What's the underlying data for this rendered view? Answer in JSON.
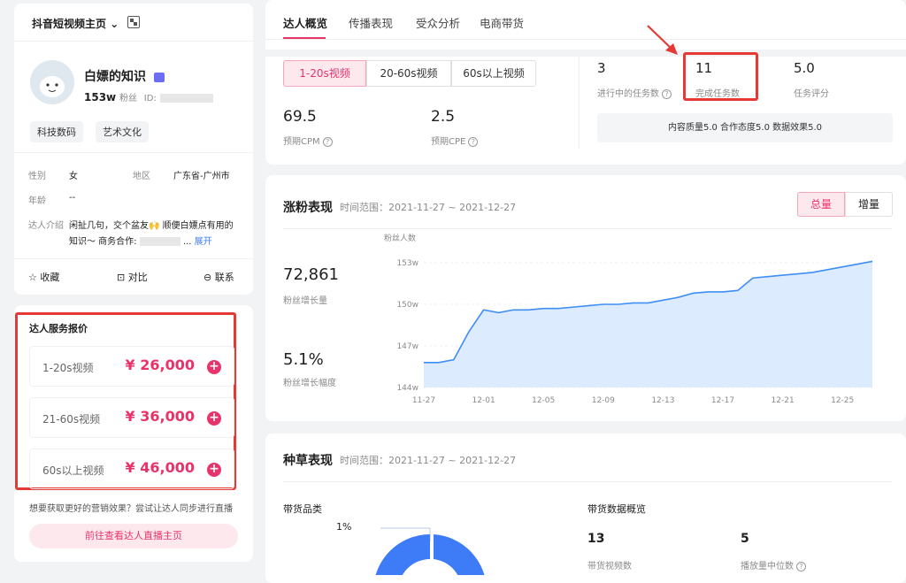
{
  "profile": {
    "platform_label": "抖音短视频主页",
    "name": "白嫖的知识",
    "followers": "153w",
    "followers_unit": "粉丝",
    "id_label": "ID:",
    "tags": [
      "科技数码",
      "艺术文化"
    ],
    "gender_label": "性别",
    "gender": "女",
    "region_label": "地区",
    "region": "广东省-广州市",
    "age_label": "年龄",
    "age": "--",
    "intro_label": "达人介绍",
    "intro_line1": "闲扯几句，交个盆友🙌 顺便白嫖点有用的",
    "intro_line2": "知识～ 商务合作:",
    "expand": "展开",
    "actions": {
      "favorite": "收藏",
      "compare": "对比",
      "contact": "联系"
    }
  },
  "pricing": {
    "title": "达人服务报价",
    "rows": [
      {
        "label": "1-20s视频",
        "price": "¥ 26,000"
      },
      {
        "label": "21-60s视频",
        "price": "¥ 36,000"
      },
      {
        "label": "60s以上视频",
        "price": "¥ 46,000"
      }
    ],
    "promo": "想要获取更好的营销效果？尝试让达人同步进行直播",
    "live_button": "前往查看达人直播主页"
  },
  "tabs": [
    "达人概览",
    "传播表现",
    "受众分析",
    "电商带货"
  ],
  "overview": {
    "segments": [
      "1-20s视频",
      "20-60s视频",
      "60s以上视频"
    ],
    "cpm_value": "69.5",
    "cpm_label": "预期CPM",
    "cpe_value": "2.5",
    "cpe_label": "预期CPE",
    "tasks_in_progress": "3",
    "tasks_in_progress_label": "进行中的任务数",
    "tasks_done": "11",
    "tasks_done_label": "完成任务数",
    "task_score": "5.0",
    "task_score_label": "任务评分",
    "quality_line": "内容质量5.0 合作态度5.0 数据效果5.0"
  },
  "growth": {
    "title": "涨粉表现",
    "range": "时间范围：2021-11-27 ~ 2021-12-27",
    "toggle_total": "总量",
    "toggle_incr": "增量",
    "stat_value": "72,861",
    "stat_label": "粉丝增长量",
    "rate_value": "5.1%",
    "rate_label": "粉丝增长幅度"
  },
  "chart_data": {
    "type": "area",
    "ylabel": "粉丝人数",
    "y_ticks": [
      "153w",
      "150w",
      "147w",
      "144w"
    ],
    "x_ticks": [
      "11-27",
      "12-01",
      "12-05",
      "12-09",
      "12-13",
      "12-17",
      "12-21",
      "12-25"
    ],
    "ylim": [
      144,
      153
    ],
    "x": [
      "11-27",
      "11-28",
      "11-29",
      "11-30",
      "12-01",
      "12-02",
      "12-03",
      "12-04",
      "12-05",
      "12-06",
      "12-07",
      "12-08",
      "12-09",
      "12-10",
      "12-11",
      "12-12",
      "12-13",
      "12-14",
      "12-15",
      "12-16",
      "12-17",
      "12-18",
      "12-19",
      "12-20",
      "12-21",
      "12-22",
      "12-23",
      "12-24",
      "12-25",
      "12-26",
      "12-27"
    ],
    "values": [
      145.8,
      145.8,
      146.0,
      148.0,
      149.6,
      149.4,
      149.6,
      149.6,
      149.7,
      149.7,
      149.8,
      149.9,
      150.0,
      150.0,
      150.1,
      150.1,
      150.3,
      150.5,
      150.8,
      150.9,
      150.9,
      151.0,
      151.9,
      152.0,
      152.1,
      152.2,
      152.3,
      152.5,
      152.7,
      152.9,
      153.1
    ],
    "color": "#3e8ef7",
    "fill": "#dcebfd"
  },
  "seeding": {
    "title": "种草表现",
    "range": "时间范围：2021-11-27 ~ 2021-12-27",
    "category_label": "带货品类",
    "pct": "1%",
    "sales_overview": "带货数据概览",
    "videos_value": "13",
    "videos_label": "带货视频数",
    "median_value": "5",
    "median_label": "播放量中位数"
  },
  "colors": {
    "accent": "#e8336a",
    "highlight": "#e53935",
    "chart_line": "#3e8ef7"
  }
}
